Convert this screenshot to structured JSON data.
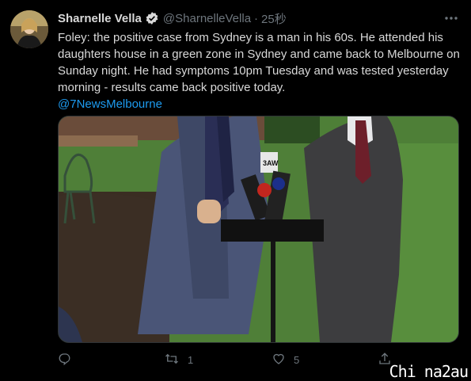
{
  "tweet": {
    "author_name": "Sharnelle Vella",
    "author_handle": "@SharnelleVella",
    "separator": "·",
    "timestamp": "25秒",
    "text": "Foley: the positive case from Sydney is a man in his 60s. He attended his daughters house in a green zone in Sydney and came back to Melbourne on Sunday night. He had symptoms 10pm Tuesday and was tested yesterday morning - results came back positive today.",
    "mention": "@7NewsMelbourne",
    "media": {
      "microphone_tag": "3AW"
    }
  },
  "actions": {
    "reply_count": "",
    "retweet_count": "1",
    "like_count": "5"
  },
  "icons": {
    "verified": "verified-badge-icon",
    "more": "more-options-icon",
    "reply": "reply-icon",
    "retweet": "retweet-icon",
    "like": "heart-icon",
    "share": "share-icon"
  },
  "colors": {
    "background": "#000000",
    "text": "#d9d9d9",
    "muted": "#6e767d",
    "link": "#1d9bf0"
  },
  "watermark": "Chi na2au"
}
